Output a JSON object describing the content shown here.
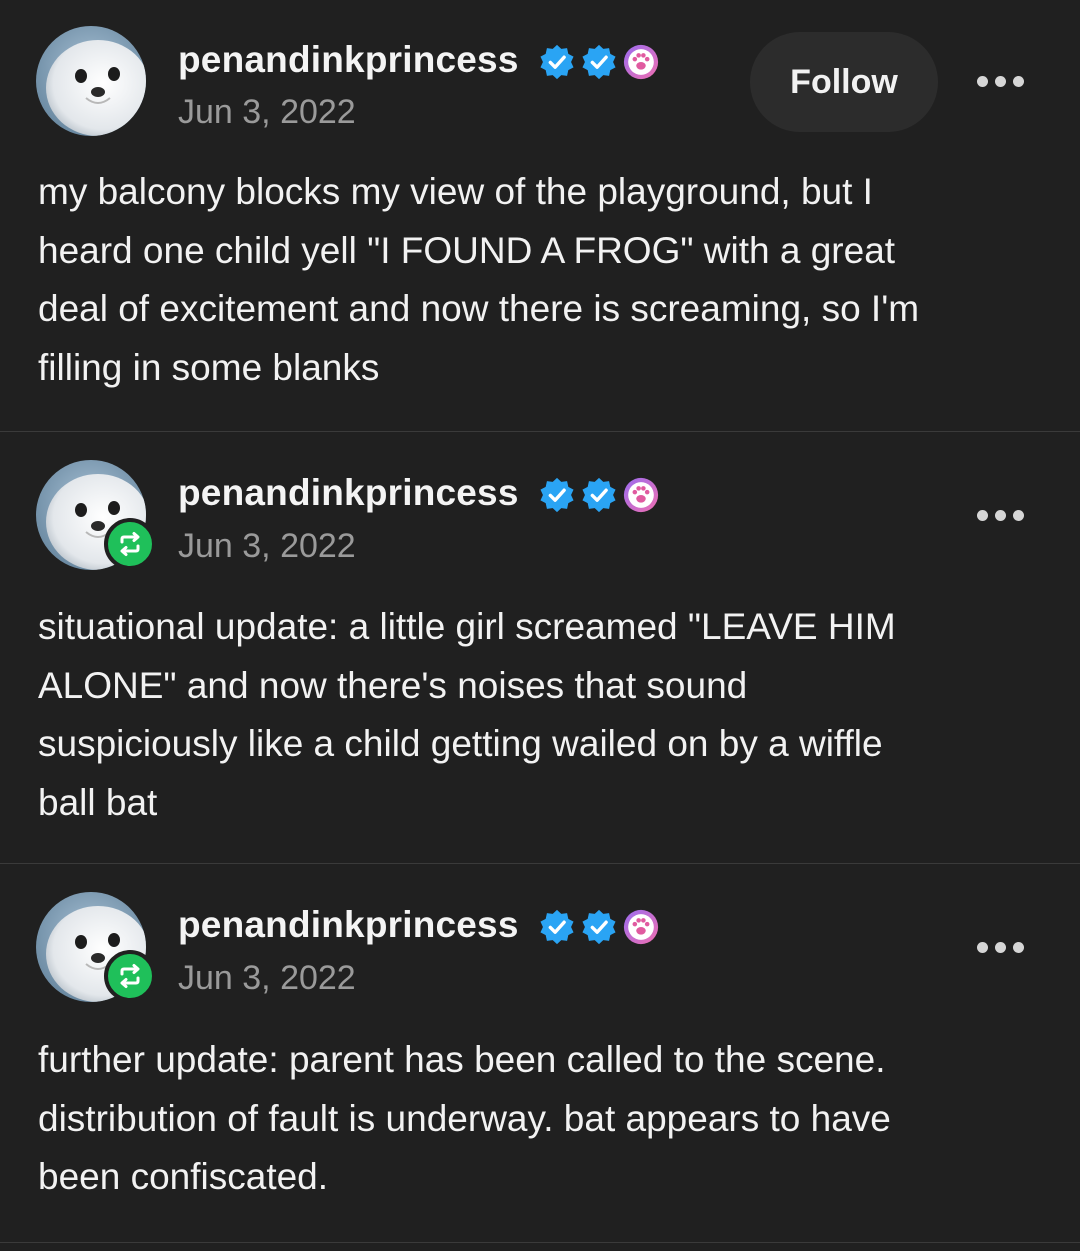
{
  "posts": [
    {
      "username": "penandinkprincess",
      "date": "Jun 3, 2022",
      "follow_label": "Follow",
      "is_reblog": false,
      "body_lines": [
        "my balcony blocks my view of the playground, but I",
        "heard one child yell \"I FOUND A FROG\" with a great",
        "deal of excitement and now there is screaming, so I'm",
        "filling in some blanks"
      ]
    },
    {
      "username": "penandinkprincess",
      "date": "Jun 3, 2022",
      "is_reblog": true,
      "body_lines": [
        "situational update: a little girl screamed \"LEAVE HIM",
        "ALONE\" and now there's noises that sound",
        "suspiciously like a child getting wailed on by a wiffle",
        "ball bat"
      ]
    },
    {
      "username": "penandinkprincess",
      "date": "Jun 3, 2022",
      "is_reblog": true,
      "body_lines": [
        "further update: parent has been called to the scene.",
        "distribution of fault is underway. bat appears to have",
        "been confiscated."
      ]
    }
  ],
  "icons": {
    "verified_badge": "blue-verified-badge-icon",
    "pink_badge": "paw-badge-icon",
    "reblog": "reblog-icon",
    "more": "more-options-icon"
  },
  "colors": {
    "background": "#202020",
    "verified_blue": "#2aa4f4",
    "reblog_green": "#1fc05a",
    "paw_badge_pink": "#c75fd0"
  }
}
